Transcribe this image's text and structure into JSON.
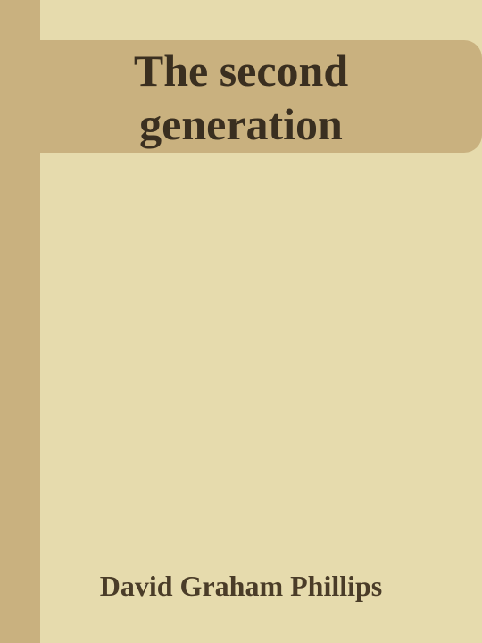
{
  "book": {
    "title": "The second generation",
    "author": "David Graham Phillips"
  },
  "colors": {
    "background": "#e6dbad",
    "accent": "#c9b17f",
    "title_text": "#3a2f20",
    "author_text": "#4a3c28"
  }
}
